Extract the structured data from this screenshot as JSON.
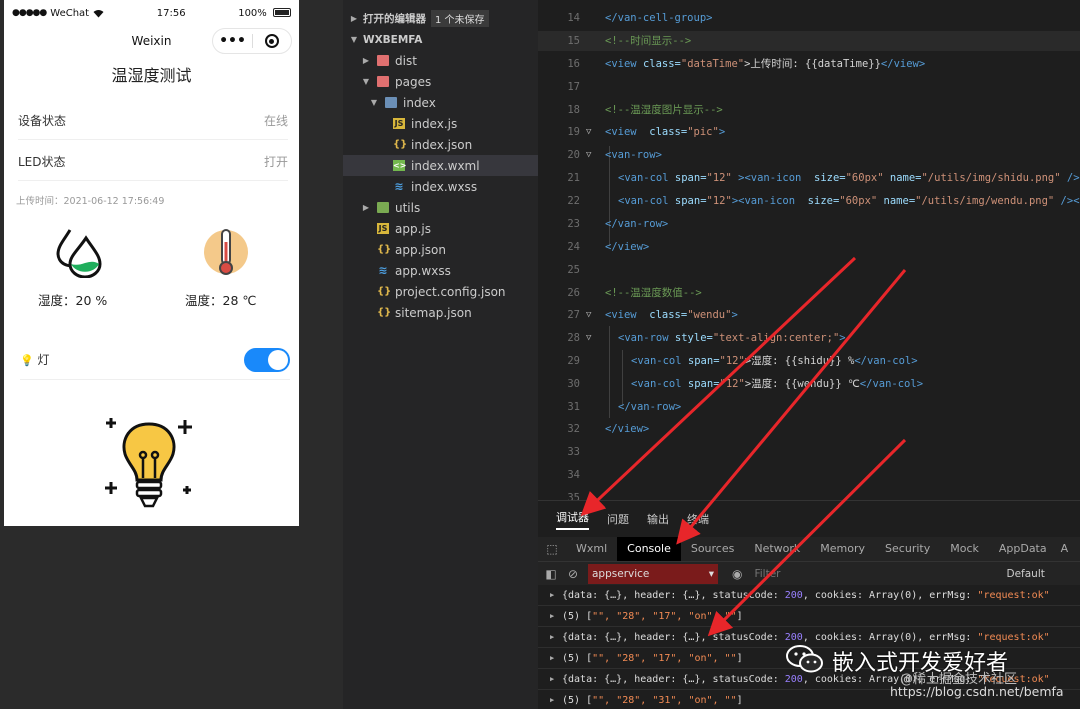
{
  "phone": {
    "signal": "●●●●●",
    "carrier": "WeChat",
    "time": "17:56",
    "battery": "100%",
    "nav_title": "Weixin",
    "page_title": "温湿度测试",
    "cells": [
      {
        "label": "设备状态",
        "value": "在线"
      },
      {
        "label": "LED状态",
        "value": "打开"
      }
    ],
    "upload_time": "上传时间：2021-06-12 17:56:49",
    "humidity": "湿度：20 %",
    "temperature": "温度：28 ℃",
    "light_label": "灯"
  },
  "explorer": {
    "open_editors": "打开的编辑器",
    "unsaved_badge": "1 个未保存",
    "project": "WXBEMFA",
    "items": [
      {
        "name": "dist",
        "type": "folder-red"
      },
      {
        "name": "pages",
        "type": "folder-red"
      },
      {
        "name": "index",
        "type": "folder-blue"
      },
      {
        "name": "index.js",
        "type": "js"
      },
      {
        "name": "index.json",
        "type": "json"
      },
      {
        "name": "index.wxml",
        "type": "wxml"
      },
      {
        "name": "index.wxss",
        "type": "wxss"
      },
      {
        "name": "utils",
        "type": "folder-green"
      },
      {
        "name": "app.js",
        "type": "js"
      },
      {
        "name": "app.json",
        "type": "json"
      },
      {
        "name": "app.wxss",
        "type": "wxss"
      },
      {
        "name": "project.config.json",
        "type": "json"
      },
      {
        "name": "sitemap.json",
        "type": "json"
      }
    ]
  },
  "editor": {
    "line_numbers": [
      "14",
      "15",
      "16",
      "17",
      "18",
      "19",
      "20",
      "21",
      "22",
      "23",
      "24",
      "25",
      "26",
      "27",
      "28",
      "29",
      "30",
      "31",
      "32",
      "33",
      "34",
      "35"
    ],
    "texts": {
      "l14": "</van-cell-group>",
      "l15": "<!--时间显示-->",
      "l16_a": "<view ",
      "l16_b": "class=",
      "l16_c": "\"dataTime\"",
      "l16_d": ">上传时间: {{dataTime}}",
      "l16_e": "</view>",
      "l18": "<!--温湿度图片显示-->",
      "l19_a": "<view  ",
      "l19_b": "class=",
      "l19_c": "\"pic\"",
      "l19_d": ">",
      "l20": "<van-row>",
      "l21_a": "<van-col ",
      "l21_b": "span=",
      "l21_c": "\"12\"",
      "l21_d": " ><van-icon  ",
      "l21_e": "size=",
      "l21_f": "\"60px\"",
      "l21_g": " name=",
      "l21_h": "\"/utils/img/shidu.png\"",
      "l21_i": " /></",
      "l22_a": "<van-col ",
      "l22_b": "span=",
      "l22_c": "\"12\"",
      "l22_d": "><van-icon  ",
      "l22_e": "size=",
      "l22_f": "\"60px\"",
      "l22_g": " name=",
      "l22_h": "\"/utils/img/wendu.png\"",
      "l22_i": " /></",
      "l23": "</van-row>",
      "l24": "</view>",
      "l26": "<!--温湿度数值-->",
      "l27_a": "<view  ",
      "l27_b": "class=",
      "l27_c": "\"wendu\"",
      "l27_d": ">",
      "l28_a": "<van-row ",
      "l28_b": "style=",
      "l28_c": "\"text-align:center;\"",
      "l28_d": ">",
      "l29_a": "<van-col ",
      "l29_b": "span=",
      "l29_c": "\"12\"",
      "l29_d": ">湿度: {{shidu}} %",
      "l29_e": "</van-col>",
      "l30_a": "<van-col ",
      "l30_b": "span=",
      "l30_c": "\"12\"",
      "l30_d": ">温度: {{wendu}} ℃",
      "l30_e": "</van-col>",
      "l31": "</van-row>",
      "l32": "</view>"
    }
  },
  "devtools": {
    "top_tabs": [
      "调试器",
      "问题",
      "输出",
      "终端"
    ],
    "panel_tabs": [
      "Wxml",
      "Console",
      "Sources",
      "Network",
      "Memory",
      "Security",
      "Mock",
      "AppData",
      "A"
    ],
    "context": "appservice",
    "filter_placeholder": "Filter",
    "level": "Default",
    "log_obj_a": "{data: {…}, header: {…}, statusCode: ",
    "log_obj_code": "200",
    "log_obj_b": ", cookies: Array(0), errMsg: ",
    "log_obj_msg": "\"request:ok\"",
    "log_arr_prefix": "(5) [",
    "log_arr_1": "\"\", \"28\", \"17\", \"on\", \"\"",
    "log_arr_2": "\"\", \"28\", \"17\", \"on\", \"\"",
    "log_arr_3": "\"\", \"28\", \"31\", \"on\", \"\"",
    "log_arr_suffix": "]"
  },
  "watermark": {
    "main": "嵌入式开发爱好者",
    "sub": "@稀土掘金技术社区",
    "url": "https://blog.csdn.net/bemfa"
  },
  "colors": {
    "toggle_on": "#1989fa",
    "arrow_red": "#e8262a",
    "editor_bg": "#1e1e1e"
  }
}
